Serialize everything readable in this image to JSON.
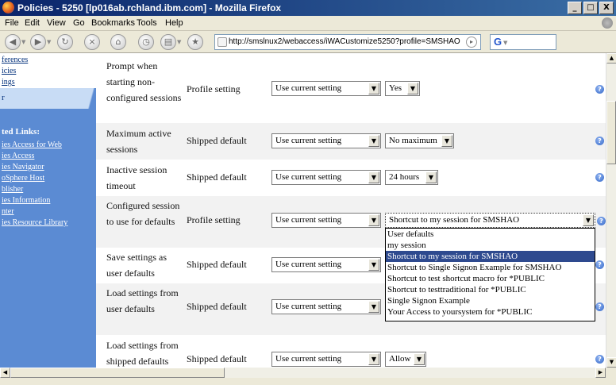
{
  "window": {
    "title": "Policies - 5250 [lp016ab.rchland.ibm.com] - Mozilla Firefox",
    "minimize": "_",
    "maximize": "□",
    "close": "X"
  },
  "menu": [
    "File",
    "Edit",
    "View",
    "Go",
    "Bookmarks",
    "Tools",
    "Help"
  ],
  "address_bar": {
    "url": "http://smslnux2/webaccess/iWACustomize5250?profile=SMSHAO"
  },
  "search_engine_glyph": "G",
  "sidebar": {
    "top_items": [
      "ferences",
      "icies",
      "ings"
    ],
    "current_tab": "r",
    "related_heading": "ted Links:",
    "related_links": [
      "ies Access for Web",
      "ies Access",
      "ies Navigator",
      "oSphere Host",
      "blisher",
      "ies Information",
      "nter",
      "ies Resource Library"
    ]
  },
  "rows": [
    {
      "name": "Prompt when starting non-configured sessions",
      "source": "Profile setting",
      "setting": "Use current setting",
      "value": "Yes"
    },
    {
      "name": "Maximum active sessions",
      "source": "Shipped default",
      "setting": "Use current setting",
      "value": "No maximum"
    },
    {
      "name": "Inactive session timeout",
      "source": "Shipped default",
      "setting": "Use current setting",
      "value": "24 hours"
    },
    {
      "name": "Configured session to use for defaults",
      "source": "Profile setting",
      "setting": "Use current setting",
      "value": "Shortcut to my session for SMSHAO"
    },
    {
      "name": "Save settings as user defaults",
      "source": "Shipped default",
      "setting": "Use current setting",
      "value": ""
    },
    {
      "name": "Load settings from user defaults",
      "source": "Shipped default",
      "setting": "Use current setting",
      "value": ""
    },
    {
      "name": "Load settings from shipped defaults",
      "source": "Shipped default",
      "setting": "Use current setting",
      "value": "Allow"
    }
  ],
  "dropdown": {
    "options": [
      "User defaults",
      "my session",
      "Shortcut to my session for SMSHAO",
      "Shortcut to Single Signon Example for SMSHAO",
      "Shortcut to test shortcut macro for *PUBLIC",
      "Shortcut to testtraditional for *PUBLIC",
      "Single Signon Example",
      "Your Access to yoursystem for *PUBLIC"
    ],
    "selected": "Shortcut to my session for SMSHAO"
  },
  "help_glyph": "?",
  "colors": {
    "sidebar_bg": "#5b8bd3",
    "selected_option_bg": "#2e4a8f",
    "title_bar": "#0a246a"
  },
  "icons": [
    "firefox-logo-icon",
    "back-icon",
    "forward-icon",
    "reload-icon",
    "stop-icon",
    "home-icon",
    "history-icon",
    "print-icon",
    "bookmark-icon",
    "help-icon",
    "google-icon",
    "throbber-icon"
  ]
}
